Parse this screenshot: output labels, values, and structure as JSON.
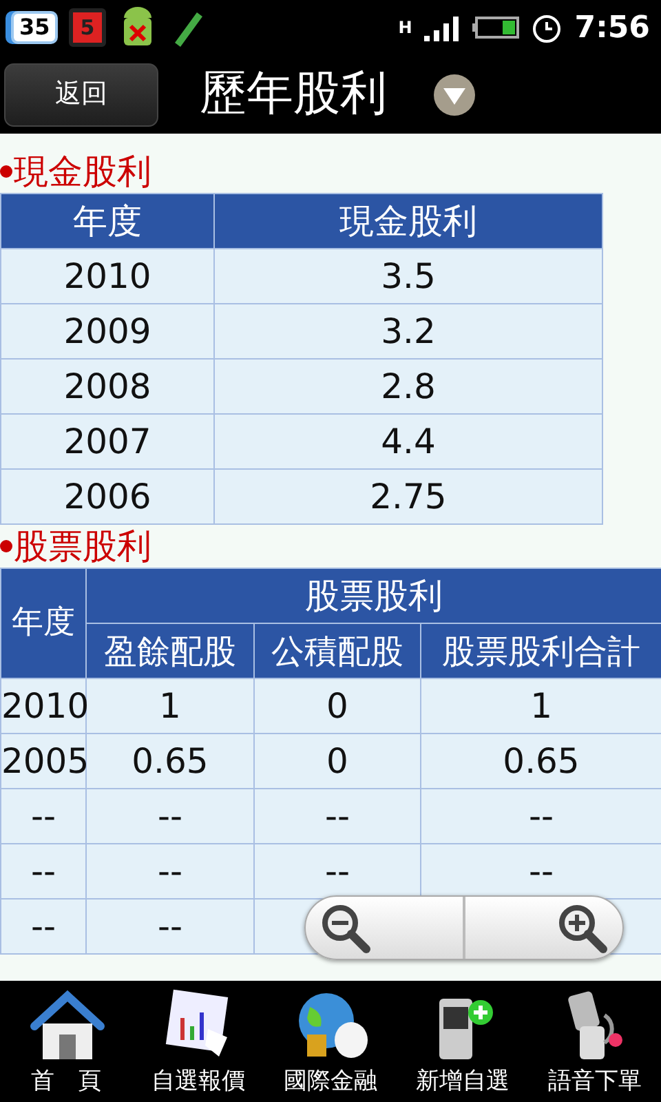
{
  "status_bar": {
    "notification_count": "35",
    "app_badge": "5",
    "network_type": "H",
    "time": "7:56"
  },
  "header": {
    "back_button": "返回",
    "title": "歷年股利"
  },
  "cash_dividend": {
    "title": "現金股利",
    "columns": [
      "年度",
      "現金股利"
    ],
    "rows": [
      [
        "2010",
        "3.5"
      ],
      [
        "2009",
        "3.2"
      ],
      [
        "2008",
        "2.8"
      ],
      [
        "2007",
        "4.4"
      ],
      [
        "2006",
        "2.75"
      ]
    ]
  },
  "stock_dividend": {
    "title": "股票股利",
    "year_column": "年度",
    "group_column": "股票股利",
    "sub_columns": [
      "盈餘配股",
      "公積配股",
      "股票股利合計"
    ],
    "rows": [
      [
        "2010",
        "1",
        "0",
        "1"
      ],
      [
        "2005",
        "0.65",
        "0",
        "0.65"
      ],
      [
        "--",
        "--",
        "--",
        "--"
      ],
      [
        "--",
        "--",
        "--",
        "--"
      ],
      [
        "--",
        "--"
      ]
    ]
  },
  "bottom_nav": [
    {
      "label": "首　頁"
    },
    {
      "label": "自選報價"
    },
    {
      "label": "國際金融"
    },
    {
      "label": "新增自選"
    },
    {
      "label": "語音下單"
    }
  ]
}
